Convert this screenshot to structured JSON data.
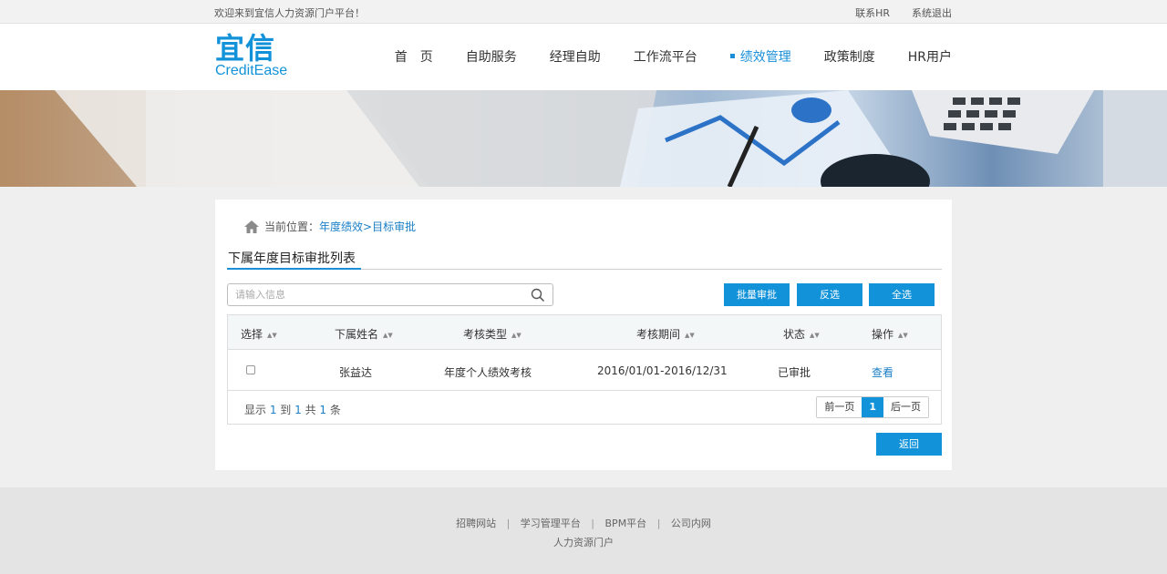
{
  "topbar": {
    "welcome": "欢迎来到宜信人力资源门户平台！",
    "links": [
      "联系HR",
      "系统退出"
    ]
  },
  "logo": {
    "cn": "宜信",
    "en": "CreditEase"
  },
  "nav": {
    "items": [
      "首　页",
      "自助服务",
      "经理自助",
      "工作流平台",
      "绩效管理",
      "政策制度",
      "HR用户"
    ],
    "active_index": 4
  },
  "breadcrumb": {
    "prefix": "当前位置：",
    "path1": "年度绩效",
    "sep": ">",
    "path2": "目标审批"
  },
  "section_title": "下属年度目标审批列表",
  "search": {
    "placeholder": "请输入信息",
    "value": ""
  },
  "buttons": {
    "batch": "批量审批",
    "invert": "反选",
    "all": "全选",
    "back": "返回"
  },
  "table": {
    "headers": [
      "选择",
      "下属姓名",
      "考核类型",
      "考核期间",
      "状态",
      "操作"
    ],
    "rows": [
      {
        "checked": false,
        "name": "张益达",
        "type": "年度个人绩效考核",
        "period": "2016/01/01-2016/12/31",
        "status": "已审批",
        "action": "查看"
      }
    ]
  },
  "pagination": {
    "info_pre": "显示 ",
    "from": "1",
    "info_mid1": " 到 ",
    "to": "1",
    "info_mid2": " 共 ",
    "total": "1",
    "info_post": " 条",
    "prev": "前一页",
    "current": "1",
    "next": "后一页"
  },
  "footer": {
    "links": [
      "招聘网站",
      "学习管理平台",
      "BPM平台",
      "公司内网"
    ],
    "divider": "|",
    "sub": "人力资源门户"
  },
  "colors": {
    "primary": "#1192d9",
    "link": "#1a7fc6"
  }
}
